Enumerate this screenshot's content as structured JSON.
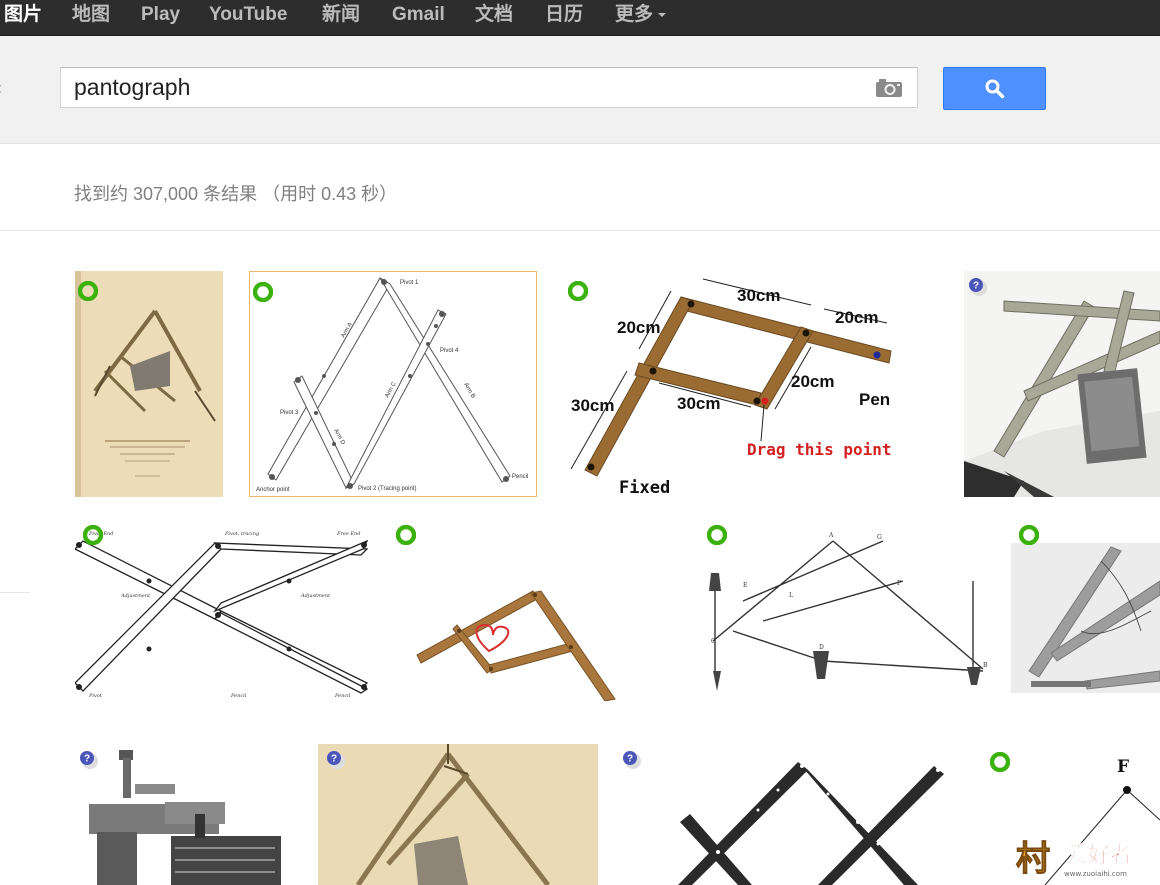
{
  "topbar": {
    "items": [
      {
        "label": "图片",
        "active": true
      },
      {
        "label": "地图",
        "active": false
      },
      {
        "label": "Play",
        "active": false
      },
      {
        "label": "YouTube",
        "active": false
      },
      {
        "label": "新闻",
        "active": false
      },
      {
        "label": "Gmail",
        "active": false
      },
      {
        "label": "文档",
        "active": false
      },
      {
        "label": "日历",
        "active": false
      },
      {
        "label": "更多",
        "active": false,
        "dropdown": true
      }
    ]
  },
  "search": {
    "query": "pantograph",
    "camera_icon": "camera-icon",
    "button_icon": "search-icon",
    "button_color": "#4d90fe"
  },
  "results": {
    "stats": "找到约 307,000 条结果 （用时 0.43 秒）"
  },
  "thumbnails": {
    "row1": [
      {
        "name": "thumb-r1-1",
        "badge": "green"
      },
      {
        "name": "thumb-r1-2",
        "badge": "green",
        "labels": {
          "pivot1": "Pivot 1",
          "pivot4": "Pivot 4",
          "pivot3": "Pivot 3",
          "pivot2": "Pivot 2 (Tracing point)",
          "anchor": "Anchor point",
          "pencil": "Pencil",
          "arma": "Arm A",
          "armb": "Arm B",
          "armc": "Arm C",
          "armd": "Arm D"
        }
      },
      {
        "name": "thumb-r1-3",
        "badge": "green",
        "labels": {
          "top": "30cm",
          "topright": "20cm",
          "left": "20cm",
          "mid": "30cm",
          "right": "20cm",
          "bottomleft": "30cm",
          "pen": "Pen",
          "drag": "Drag this point",
          "fixed": "Fixed"
        }
      },
      {
        "name": "thumb-r1-4",
        "badge": "question"
      }
    ],
    "row2": [
      {
        "name": "thumb-r2-1",
        "badge": "green"
      },
      {
        "name": "thumb-r2-2",
        "badge": "green"
      },
      {
        "name": "thumb-r2-3",
        "badge": "green"
      },
      {
        "name": "thumb-r2-4",
        "badge": "green"
      }
    ],
    "row3": [
      {
        "name": "thumb-r3-1",
        "badge": "question"
      },
      {
        "name": "thumb-r3-2",
        "badge": "question"
      },
      {
        "name": "thumb-r3-3",
        "badge": "question"
      },
      {
        "name": "thumb-r3-4",
        "badge": "green",
        "labels": {
          "f": "F"
        }
      }
    ]
  },
  "watermark": {
    "text": "爱好者",
    "site": "www.zuoiaihi.com"
  }
}
